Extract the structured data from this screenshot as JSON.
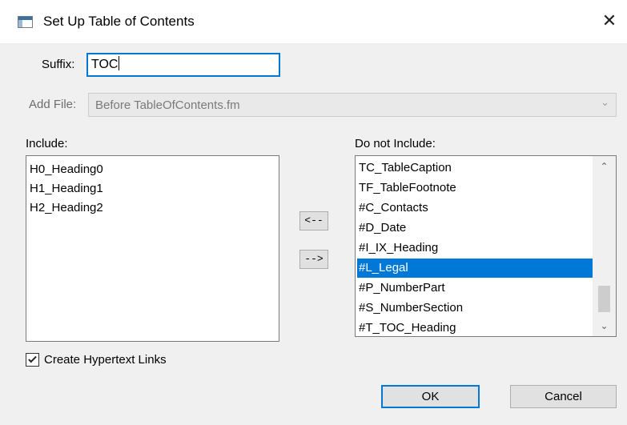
{
  "window": {
    "title": "Set Up Table of Contents",
    "close_glyph": "✕"
  },
  "suffix": {
    "label": "Suffix:",
    "value": "TOC"
  },
  "add_file": {
    "label": "Add File:",
    "value": "Before TableOfContents.fm",
    "disabled": true
  },
  "include": {
    "label": "Include:",
    "items": [
      "H0_Heading0",
      "H1_Heading1",
      "H2_Heading2"
    ]
  },
  "exclude": {
    "label": "Do not Include:",
    "items": [
      "TC_TableCaption",
      "TF_TableFootnote",
      "#C_Contacts",
      "#D_Date",
      "#I_IX_Heading",
      "#L_Legal",
      "#P_NumberPart",
      "#S_NumberSection",
      "#T_TOC_Heading"
    ],
    "selected_item": "#L_Legal"
  },
  "move_buttons": {
    "move_left": "<--",
    "move_right": "-->"
  },
  "hypertext": {
    "label": "Create Hypertext Links",
    "checked": true
  },
  "buttons": {
    "ok": "OK",
    "cancel": "Cancel"
  },
  "icons": {
    "window": "dialog-window-icon",
    "close": "close-icon",
    "dropdown": "chevron-down-icon",
    "scroll_up": "chevron-up-icon",
    "scroll_down": "chevron-down-icon",
    "check": "check-icon"
  },
  "colors": {
    "accent": "#0078d7",
    "selection": "#0078d7",
    "dialog_bg": "#f0f0f0",
    "titlebar_bg": "#ffffff"
  }
}
